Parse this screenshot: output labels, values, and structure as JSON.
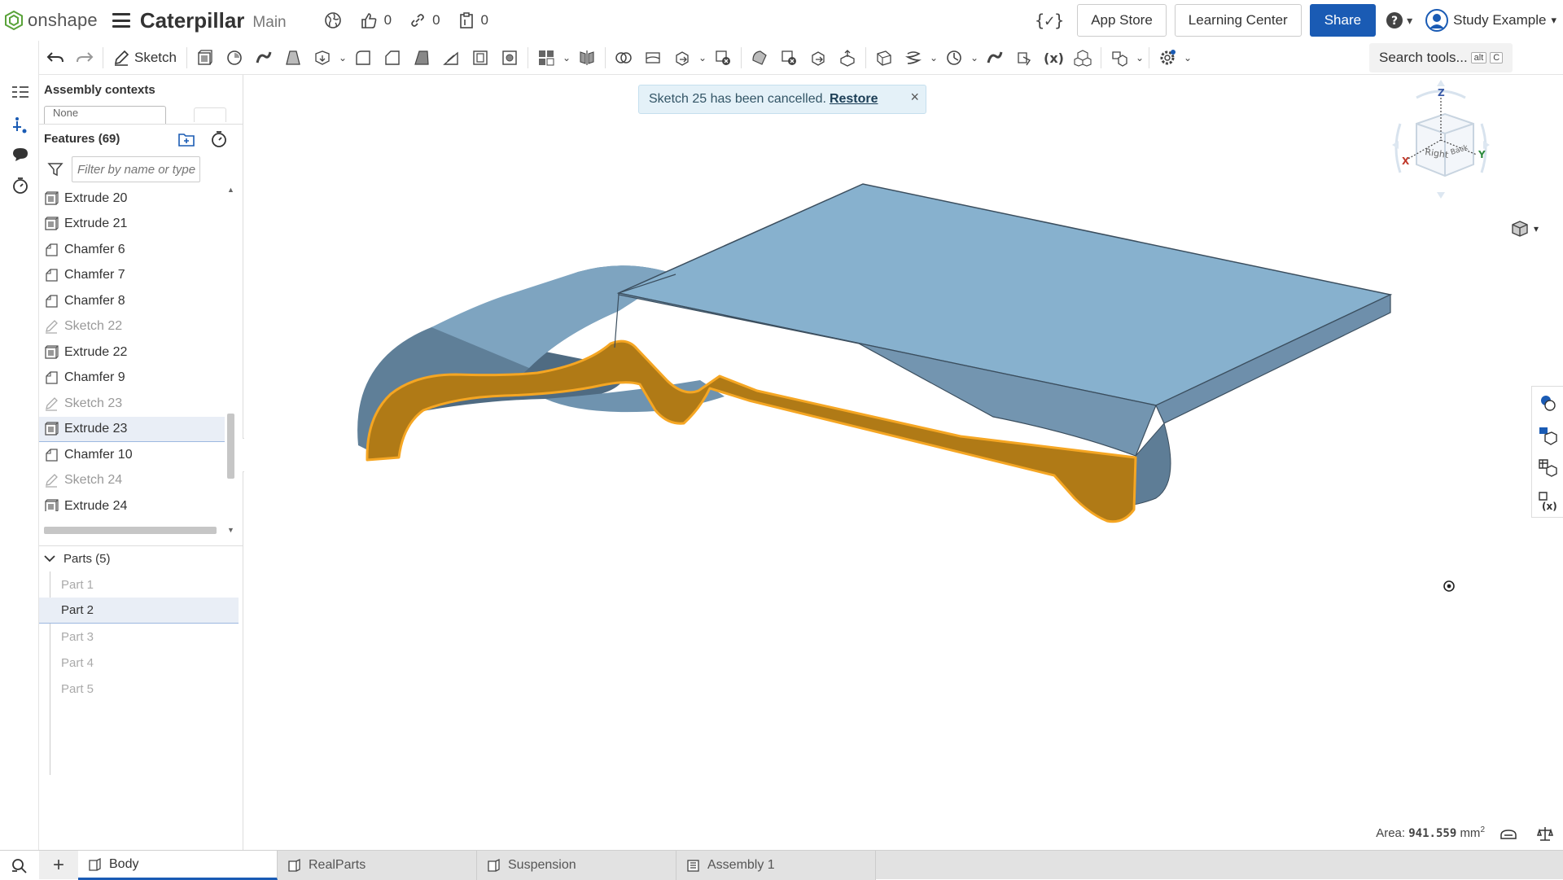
{
  "topbar": {
    "logo_text": "onshape",
    "doc_title": "Caterpillar",
    "branch": "Main",
    "likes": "0",
    "links": "0",
    "copies": "0",
    "app_store": "App Store",
    "learning_center": "Learning Center",
    "share": "Share",
    "user": "Study Example"
  },
  "toolbar": {
    "sketch_label": "Sketch",
    "search_label": "Search tools...",
    "search_kbd_1": "alt",
    "search_kbd_2": "C",
    "fx_label": "(x)"
  },
  "panel": {
    "assembly_contexts": "Assembly contexts",
    "assembly_select": "None",
    "features_title": "Features (69)",
    "filter_placeholder": "Filter by name or type",
    "features": [
      {
        "label": "Extrude 20",
        "type": "extrude"
      },
      {
        "label": "Extrude 21",
        "type": "extrude"
      },
      {
        "label": "Chamfer 6",
        "type": "chamfer"
      },
      {
        "label": "Chamfer 7",
        "type": "chamfer"
      },
      {
        "label": "Chamfer 8",
        "type": "chamfer"
      },
      {
        "label": "Sketch 22",
        "type": "sketch"
      },
      {
        "label": "Extrude 22",
        "type": "extrude"
      },
      {
        "label": "Chamfer 9",
        "type": "chamfer"
      },
      {
        "label": "Sketch 23",
        "type": "sketch"
      },
      {
        "label": "Extrude 23",
        "type": "extrude",
        "selected": true
      },
      {
        "label": "Chamfer 10",
        "type": "chamfer"
      },
      {
        "label": "Sketch 24",
        "type": "sketch"
      },
      {
        "label": "Extrude 24",
        "type": "extrude"
      }
    ],
    "parts_title": "Parts (5)",
    "parts": [
      {
        "label": "Part 1"
      },
      {
        "label": "Part 2",
        "selected": true
      },
      {
        "label": "Part 3"
      },
      {
        "label": "Part 4"
      },
      {
        "label": "Part 5"
      }
    ]
  },
  "viewport": {
    "toast_text": "Sketch 25 has been cancelled.",
    "toast_action": "Restore",
    "toast_close": "×",
    "area_label": "Area:",
    "area_value": "941.559",
    "area_unit": "mm",
    "area_exp": "2",
    "viewcube": {
      "right": "Right",
      "back": "Back",
      "x": "X",
      "y": "Y",
      "z": "Z"
    }
  },
  "tabs": [
    {
      "label": "Body",
      "active": true,
      "icon": "part-studio-icon"
    },
    {
      "label": "RealParts",
      "active": false,
      "icon": "part-studio-icon"
    },
    {
      "label": "Suspension",
      "active": false,
      "icon": "part-studio-icon"
    },
    {
      "label": "Assembly 1",
      "active": false,
      "icon": "assembly-icon"
    }
  ],
  "colors": {
    "accent": "#1a5bb4",
    "part_face_top": "#87b1ce",
    "part_face_side": "#6f94b0",
    "selected_face": "#b07a16",
    "selection_outline": "#f5a623"
  }
}
